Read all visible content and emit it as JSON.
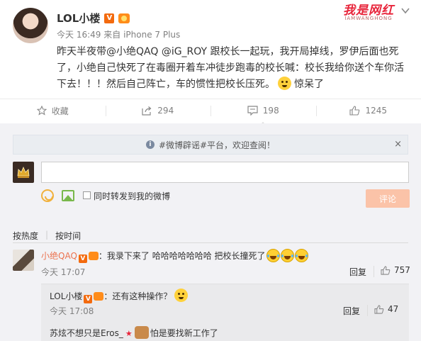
{
  "post": {
    "author": "LOL小楼",
    "time": "今天 16:49",
    "source_prefix": "来自",
    "source": "iPhone 7 Plus",
    "content_part1": "昨天半夜带@小绝QAQ @iG_ROY 跟校长一起玩，我开局掉线，罗伊后面也死了，小绝自己快死了在毒圈开着车冲徒步跑毒的校长喊：校长我给你送个车你活下去！！！然后自己阵亡，车的惯性把校长压死。",
    "content_part2": "惊呆了"
  },
  "watermark": {
    "main": "我是网红",
    "sub": "IAMWANGHONG"
  },
  "actions": {
    "favorite": "收藏",
    "repost": "294",
    "comment": "198",
    "like": "1245"
  },
  "notice": {
    "text": "#微博辟谣#平台，欢迎查阅！",
    "close": "×"
  },
  "composer": {
    "placeholder": "",
    "repost_label": "同时转发到我的微博",
    "submit": "评论"
  },
  "sort": {
    "hot": "按热度",
    "time": "按时间"
  },
  "comments": [
    {
      "name": "小绝QAQ",
      "sep": "：",
      "text": "我录下来了 哈哈哈哈哈哈哈 把校长撞死了",
      "time": "今天 17:07",
      "reply": "回复",
      "likes": "757"
    }
  ],
  "sub_comments": [
    {
      "name": "LOL小楼",
      "sep": "：",
      "text": "还有这种操作？",
      "time": "今天 17:08",
      "reply": "回复",
      "likes": "47"
    },
    {
      "name": "苏炫不想只是Eros_",
      "text": "怕是要找新工作了"
    }
  ],
  "colors": {
    "accent": "#eb7350",
    "submit_disabled": "#fbc3a8",
    "page_bg": "#f2f2f5"
  }
}
